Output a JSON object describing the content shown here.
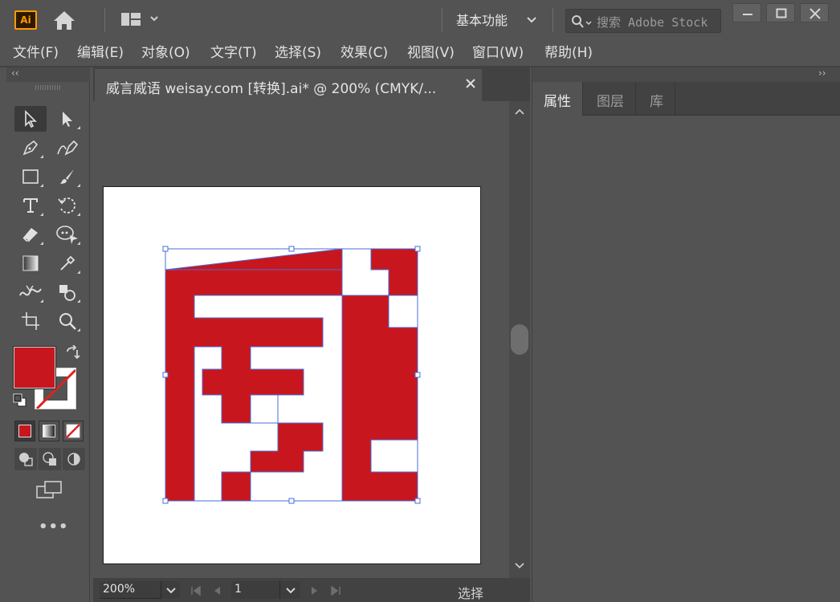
{
  "app": {
    "logo_text": "Ai",
    "workspace": "基本功能",
    "search_placeholder": "搜索 Adobe Stock"
  },
  "menu": [
    {
      "label": "文件(F)"
    },
    {
      "label": "编辑(E)"
    },
    {
      "label": "对象(O)"
    },
    {
      "label": "文字(T)"
    },
    {
      "label": "选择(S)"
    },
    {
      "label": "效果(C)"
    },
    {
      "label": "视图(V)"
    },
    {
      "label": "窗口(W)"
    },
    {
      "label": "帮助(H)"
    }
  ],
  "document": {
    "tab_title": "威言威语 weisay.com  [转换].ai* @ 200% (CMYK/...",
    "zoom": "200%",
    "page": "1",
    "status": "选择"
  },
  "panels": {
    "tabs": [
      "属性",
      "图层",
      "库"
    ]
  },
  "colors": {
    "fill": "#c8161e",
    "selection": "#4a6cd4",
    "accent_logo": "#ff9a00"
  },
  "toolbar": {
    "tools": [
      "selection-tool",
      "direct-selection-tool",
      "pen-tool",
      "curvature-tool",
      "rectangle-tool",
      "paintbrush-tool",
      "type-tool",
      "rotate-tool",
      "eraser-tool",
      "puppet-warp-tool",
      "gradient-tool",
      "eyedropper-tool",
      "width-tool",
      "shape-builder-tool",
      "artboard-tool",
      "zoom-tool"
    ]
  }
}
